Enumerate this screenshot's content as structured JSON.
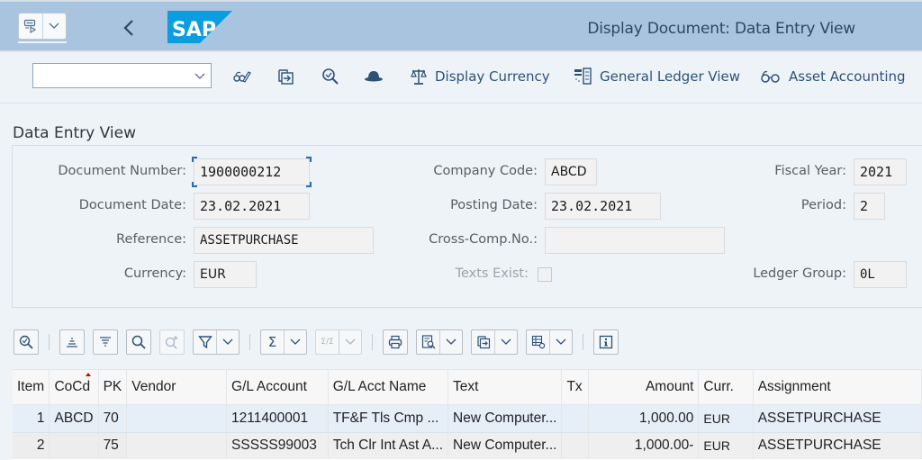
{
  "shell": {
    "title": "Display Document: Data Entry View",
    "logo_text": "SAP",
    "menu_icon": "menu-icon",
    "back_icon": "chevron-left-icon"
  },
  "toolbar": {
    "command_field_value": "",
    "icons": [
      "display-change-icon",
      "export-icon",
      "find-icon",
      "hat-icon"
    ],
    "buttons": [
      {
        "label": "Display Currency",
        "icon": "scales-icon"
      },
      {
        "label": "General Ledger View",
        "icon": "ledger-icon"
      },
      {
        "label": "Asset Accounting",
        "icon": "glasses-icon"
      }
    ]
  },
  "section": {
    "title": "Data Entry View"
  },
  "header_fields": {
    "document_number": {
      "label": "Document Number:",
      "value": "1900000212"
    },
    "document_date": {
      "label": "Document Date:",
      "value": "23.02.2021"
    },
    "reference": {
      "label": "Reference:",
      "value": "ASSETPURCHASE"
    },
    "currency": {
      "label": "Currency:",
      "value": "EUR"
    },
    "company_code": {
      "label": "Company Code:",
      "value": "ABCD"
    },
    "posting_date": {
      "label": "Posting Date:",
      "value": "23.02.2021"
    },
    "cross_comp_no": {
      "label": "Cross-Comp.No.:",
      "value": ""
    },
    "texts_exist": {
      "label": "Texts Exist:",
      "checked": false
    },
    "fiscal_year": {
      "label": "Fiscal Year:",
      "value": "2021"
    },
    "period": {
      "label": "Period:",
      "value": "2"
    },
    "ledger_group": {
      "label": "Ledger Group:",
      "value": "0L"
    }
  },
  "alv_toolbar": {
    "buttons": [
      "details-icon",
      "sort-ascending-icon",
      "sort-descending-icon",
      "find-icon",
      "find-next-icon",
      "filter-icon",
      "sum-icon",
      "subtotal-icon",
      "print-icon",
      "view-icon",
      "export-icon",
      "layout-icon",
      "info-icon"
    ]
  },
  "table": {
    "columns": [
      "Item",
      "CoCd",
      "PK",
      "Vendor",
      "G/L Account",
      "G/L Acct Name",
      "Text",
      "Tx",
      "Amount",
      "Curr.",
      "Assignment"
    ],
    "rows": [
      {
        "item": "1",
        "cocd": "ABCD",
        "pk": "70",
        "vendor": "",
        "gl_account": "1211400001",
        "gl_name": "TF&F Tls Cmp ...",
        "text": "New Computer...",
        "tx": "",
        "amount": "1,000.00",
        "curr": "EUR",
        "assignment": "ASSETPURCHASE"
      },
      {
        "item": "2",
        "cocd": "",
        "pk": "75",
        "vendor": "",
        "gl_account": "SSSSS99003",
        "gl_name": "Tch Clr Int Ast A...",
        "text": "New Computer...",
        "tx": "",
        "amount": "1,000.00-",
        "curr": "EUR",
        "assignment": "ASSETPURCHASE"
      }
    ]
  },
  "colors": {
    "shell_bg": "#a9c4de",
    "sap_blue": "#0a9ee0",
    "page_bg": "#eef3f8",
    "link_blue": "#2e5277"
  }
}
